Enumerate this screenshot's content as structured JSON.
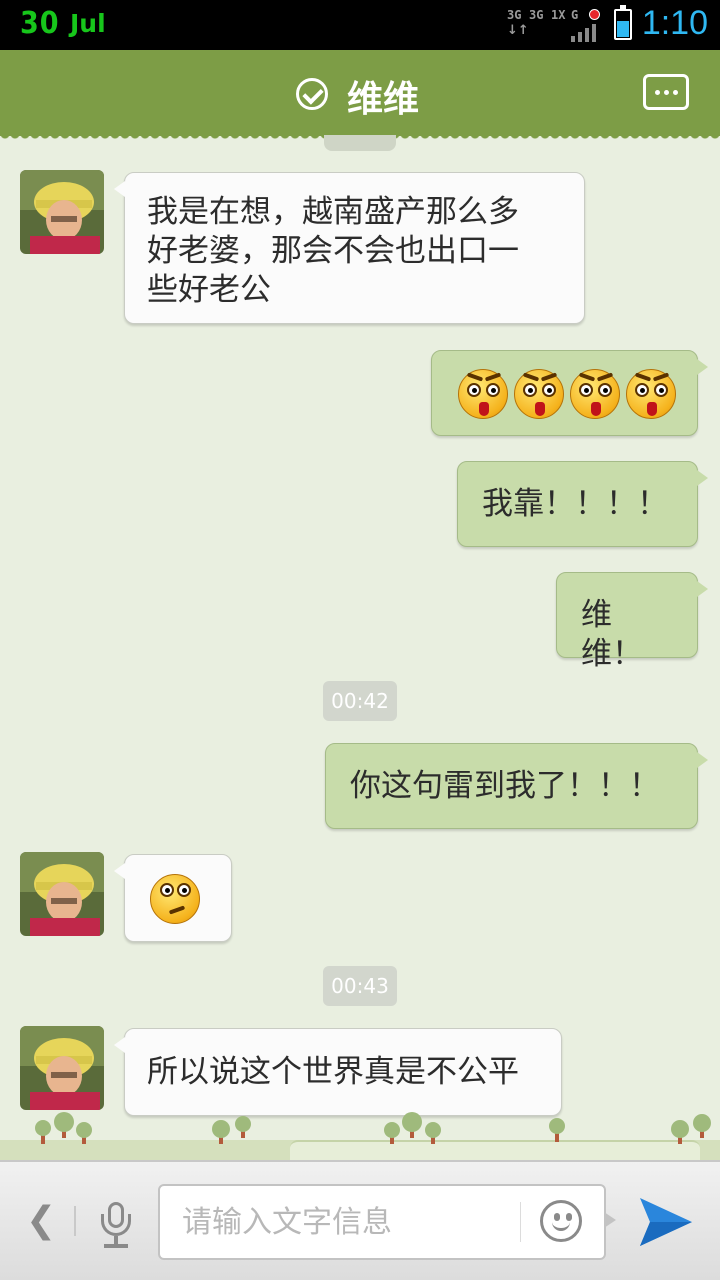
{
  "status_bar": {
    "date_day": "30",
    "date_month": "Jul",
    "time": "1:10",
    "net_labels": [
      "3G",
      "3G",
      "1X",
      "G"
    ]
  },
  "header": {
    "title": "维维",
    "check_icon": "check-circle-icon",
    "menu_icon": "more-dots-icon"
  },
  "messages": [
    {
      "side": "in",
      "text_lines": [
        "我是在想，越南盛产那么多",
        "好老婆，那会不会也出口一",
        "些好老公"
      ]
    },
    {
      "side": "out",
      "emoji": "shocked-face-icon",
      "emoji_count": 4
    },
    {
      "side": "out",
      "text": "我靠！！！！"
    },
    {
      "side": "out",
      "text": "维维！"
    },
    {
      "timestamp": "00:42"
    },
    {
      "side": "out",
      "text": "你这句雷到我了！！！"
    },
    {
      "side": "in",
      "emoji": "puzzled-face-icon",
      "emoji_count": 1
    },
    {
      "timestamp": "00:43"
    },
    {
      "side": "in",
      "text": "所以说这个世界真是不公平"
    }
  ],
  "input_bar": {
    "placeholder": "请输入文字信息",
    "back_icon": "chevron-left-icon",
    "voice_icon": "microphone-icon",
    "emoji_icon": "smiley-icon",
    "send_icon": "send-icon"
  },
  "colors": {
    "header_bg": "#7d9d46",
    "chat_bg": "#e9efe0",
    "bubble_out": "#c8dcaa",
    "bubble_in": "#fbfbfb",
    "status_date": "#17c61b",
    "status_time": "#2fb8f2",
    "send_blue": "#2a86dc"
  }
}
